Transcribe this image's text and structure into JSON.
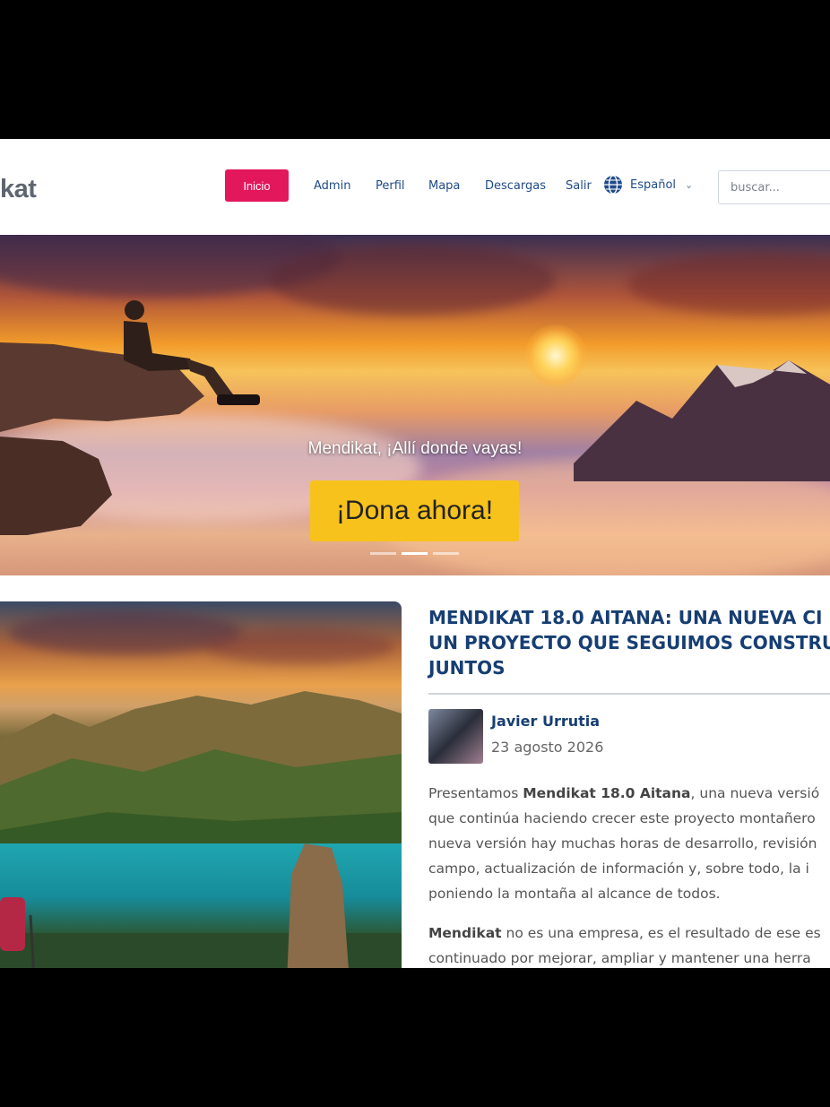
{
  "brand": {
    "logo_text": "kat"
  },
  "nav": {
    "active": "Inicio",
    "links": [
      "Admin",
      "Perfil",
      "Mapa",
      "Descargas",
      "Salir"
    ],
    "language": "Español",
    "search_placeholder": "buscar..."
  },
  "hero": {
    "caption": "Mendikat, ¡Allí donde vayas!",
    "cta": "¡Dona ahora!",
    "slides": 3,
    "active_slide": 2
  },
  "article": {
    "title_lines": [
      "MENDIKAT 18.0 AITANA: UNA NUEVA CI",
      "UN PROYECTO QUE SEGUIMOS CONSTRU",
      "JUNTOS"
    ],
    "author": "Javier Urrutia",
    "date": "23 agosto 2026",
    "p1_prefix": "Presentamos ",
    "p1_bold": "Mendikat 18.0 Aitana",
    "p1_suffix": ", una nueva versió",
    "p1_lines": [
      "que continúa haciendo crecer este proyecto montañero",
      "nueva versión hay muchas horas de desarrollo, revisión",
      "campo, actualización de información y, sobre todo, la i",
      "poniendo la montaña al alcance de todos."
    ],
    "p2_bold": "Mendikat",
    "p2_suffix": " no es una empresa, es el resultado de ese es",
    "p2_line2": "continuado por mejorar, ampliar y mantener una herra"
  },
  "colors": {
    "primary": "#e3175b",
    "cta": "#f7c21c",
    "title": "#163e73",
    "link": "#1f4a8a"
  }
}
